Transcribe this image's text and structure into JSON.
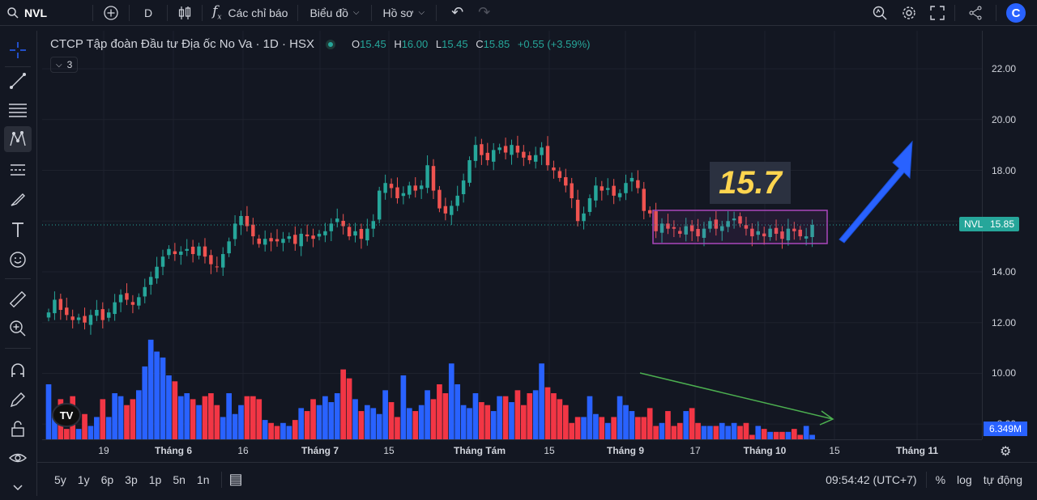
{
  "topbar": {
    "symbol": "NVL",
    "interval": "D",
    "indicators_label": "Các chỉ báo",
    "chart_label": "Biểu đồ",
    "profile_label": "Hồ sơ"
  },
  "legend": {
    "title": "CTCP Tập đoàn Đầu tư Địa ốc No Va · 1D · HSX",
    "o_label": "O",
    "o": "15.45",
    "h_label": "H",
    "h": "16.00",
    "l_label": "L",
    "l": "15.45",
    "c_label": "C",
    "c": "15.85",
    "change": "+0.55 (+3.59%)",
    "collapsed_count": "3"
  },
  "annotation": {
    "note_text": "15.7"
  },
  "price_tag": {
    "symbol": "NVL",
    "value": "15.85"
  },
  "volume_tag": "6.349M",
  "watermark": "TV",
  "y_axis": [
    "22.00",
    "20.00",
    "18.00",
    "16.00",
    "14.00",
    "12.00",
    "10.00",
    "8.00"
  ],
  "x_axis": [
    "19",
    "Tháng 6",
    "16",
    "Tháng 7",
    "15",
    "Tháng Tám",
    "15",
    "Tháng 9",
    "17",
    "Tháng 10",
    "15",
    "Tháng 11"
  ],
  "bottombar": {
    "ranges": [
      "5y",
      "1y",
      "6p",
      "3p",
      "1p",
      "5n",
      "1n"
    ],
    "time": "09:54:42 (UTC+7)",
    "percent": "%",
    "log": "log",
    "auto": "tự động"
  },
  "colors": {
    "up": "#26a69a",
    "down": "#ef5350",
    "vol_up": "#2962ff",
    "vol_down": "#f23645",
    "box": "#ab47bc",
    "arrow": "#2962ff",
    "trend": "#4caf50"
  },
  "chart_data": {
    "type": "candlestick",
    "ylim": [
      7.4,
      23.5
    ],
    "closes": [
      12.4,
      12.9,
      12.5,
      12.3,
      12.1,
      12.2,
      12.0,
      12.3,
      12.5,
      12.1,
      12.4,
      12.8,
      13.1,
      12.9,
      12.7,
      13.0,
      13.4,
      13.8,
      14.2,
      14.6,
      14.9,
      14.7,
      14.8,
      14.9,
      14.7,
      15.0,
      14.6,
      14.3,
      14.2,
      14.7,
      15.2,
      15.9,
      16.2,
      15.8,
      15.4,
      15.1,
      15.3,
      15.2,
      15.2,
      15.3,
      15.4,
      15.1,
      15.5,
      15.4,
      15.3,
      15.5,
      15.6,
      15.9,
      16.1,
      15.8,
      15.4,
      15.6,
      15.3,
      15.7,
      16.0,
      17.2,
      17.5,
      17.3,
      16.9,
      17.1,
      17.4,
      17.2,
      17.4,
      18.2,
      17.2,
      16.5,
      16.3,
      16.6,
      17.0,
      17.6,
      18.4,
      19.0,
      18.6,
      18.4,
      18.8,
      18.9,
      18.7,
      19.0,
      18.7,
      18.5,
      18.4,
      18.6,
      18.9,
      18.2,
      18.0,
      17.7,
      17.4,
      16.9,
      16.0,
      16.3,
      16.9,
      17.4,
      17.2,
      17.3,
      17.0,
      17.1,
      17.5,
      17.7,
      17.3,
      16.4,
      16.3,
      15.6,
      15.9,
      15.7,
      15.7,
      15.5,
      15.8,
      15.6,
      15.4,
      15.7,
      16.0,
      15.7,
      15.8,
      16.0,
      16.1,
      15.9,
      15.7,
      15.4,
      15.6,
      15.4,
      15.7,
      15.5,
      15.3,
      15.7,
      15.6,
      15.4,
      15.4,
      15.85
    ],
    "volume_m": [
      9.7,
      8.7,
      9.2,
      8.2,
      9.3,
      8.2,
      8.7,
      8.3,
      8.6,
      9.2,
      8.6,
      9.4,
      9.3,
      9.0,
      9.2,
      9.5,
      10.3,
      11.2,
      10.8,
      10.6,
      10.0,
      9.8,
      9.3,
      9.4,
      9.2,
      9.0,
      9.3,
      9.4,
      9.0,
      8.6,
      9.4,
      8.7,
      9.0,
      9.3,
      9.3,
      9.2,
      8.5,
      8.4,
      8.3,
      8.4,
      8.3,
      8.5,
      8.9,
      8.8,
      9.2,
      9.0,
      9.3,
      9.1,
      9.4,
      10.2,
      9.9,
      9.2,
      8.8,
      9.0,
      8.9,
      8.7,
      9.5,
      9.1,
      8.6,
      10.0,
      8.9,
      8.8,
      9.0,
      9.5,
      9.2,
      9.7,
      9.4,
      10.4,
      9.7,
      9.0,
      8.9,
      9.4,
      9.1,
      9.0,
      8.8,
      9.3,
      9.3,
      9.1,
      9.5,
      9.0,
      9.4,
      9.5,
      10.4,
      9.6,
      9.4,
      9.2,
      9.0,
      8.4,
      8.6,
      8.6,
      9.3,
      8.7,
      8.6,
      8.4,
      8.6,
      9.3,
      9.0,
      8.8,
      8.6,
      8.6,
      8.9,
      8.3,
      8.4,
      8.8,
      8.3,
      8.4,
      8.8,
      8.9,
      8.4,
      8.3,
      8.3,
      8.3,
      8.4,
      8.3,
      8.4,
      8.3,
      8.4,
      8.0,
      8.3,
      8.2,
      8.1,
      8.1,
      8.1,
      8.1,
      8.2,
      8.0,
      8.3,
      8.0,
      7.9,
      7.9
    ],
    "x_labels": [
      "19",
      "Tháng 6",
      "16",
      "Tháng 7",
      "15",
      "Tháng Tám",
      "15",
      "Tháng 9",
      "17",
      "Tháng 10",
      "15",
      "Tháng 11"
    ]
  }
}
